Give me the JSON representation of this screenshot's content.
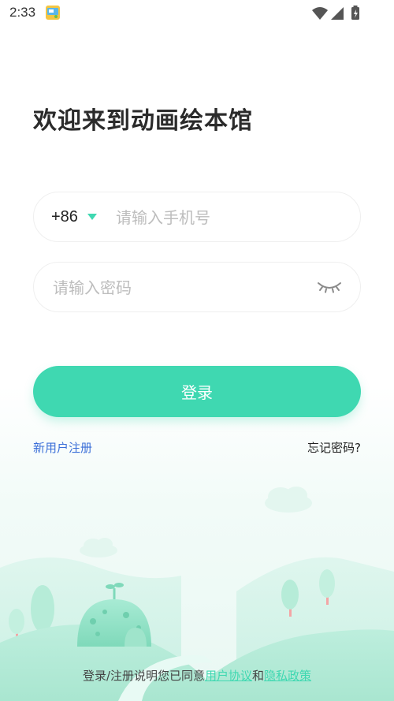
{
  "status_bar": {
    "time": "2:33"
  },
  "title": "欢迎来到动画绘本馆",
  "phone": {
    "country_code": "+86",
    "placeholder": "请输入手机号",
    "value": ""
  },
  "password": {
    "placeholder": "请输入密码",
    "value": ""
  },
  "login_button_label": "登录",
  "register_link": "新用户注册",
  "forgot_link": "忘记密码?",
  "agreement": {
    "prefix": "登录/注册说明您已同意",
    "user_agreement": "用户协议",
    "conjunction": "和",
    "privacy_policy": "隐私政策"
  },
  "colors": {
    "accent": "#3fd8b1",
    "link_blue": "#3b6fd8"
  },
  "icons": {
    "dropdown": "triangle-down-icon",
    "password_visibility": "eye-closed-icon"
  }
}
